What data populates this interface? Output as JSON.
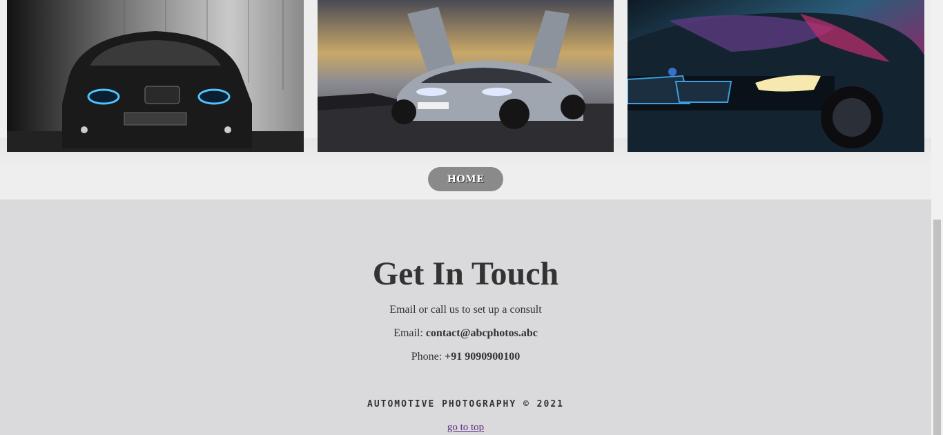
{
  "gallery": {
    "photos": [
      {
        "alt": "black-bmw-front-photo"
      },
      {
        "alt": "silver-bmw-i8-sunset-photo"
      },
      {
        "alt": "dark-bmw-i8-neon-photo"
      }
    ],
    "home_label": "HOME"
  },
  "contact": {
    "title": "Get In Touch",
    "intro": "Email or call us to set up a consult",
    "email_label": "Email:",
    "email_value": "contact@abcphotos.abc",
    "phone_label": "Phone:",
    "phone_value": "+91 9090900100"
  },
  "footer": {
    "brand": "Automotive Photography © 2021",
    "go_top": "go to top"
  },
  "colors": {
    "background": "#dadadc",
    "gallery_bg": "#eeeeee",
    "button": "#8a8a8a",
    "link": "#5a2a82"
  }
}
